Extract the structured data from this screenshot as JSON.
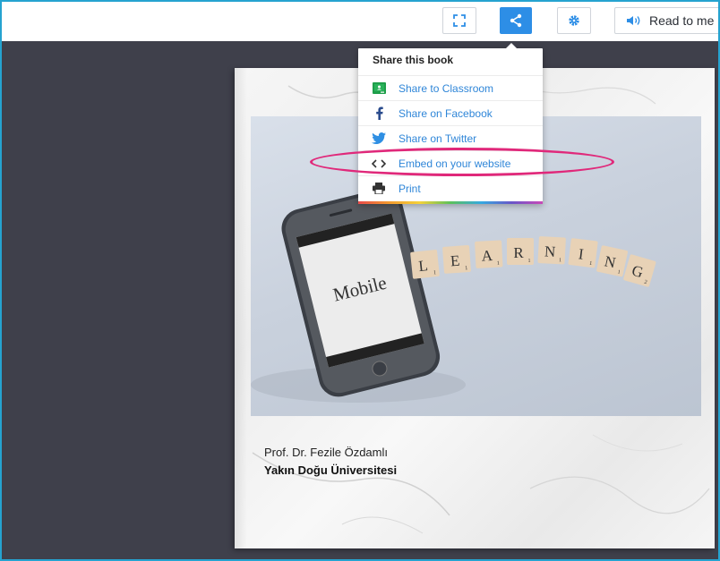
{
  "toolbar": {
    "fullscreen_icon": "fullscreen-icon",
    "share_icon": "share-icon",
    "settings_icon": "gear-icon",
    "read_icon": "speaker-icon",
    "read_label": "Read to me",
    "accent_color": "#2d8ee6"
  },
  "share_menu": {
    "title": "Share this book",
    "items": [
      {
        "label": "Share to Classroom",
        "icon": "google-classroom-icon"
      },
      {
        "label": "Share on Facebook",
        "icon": "facebook-icon"
      },
      {
        "label": "Share on Twitter",
        "icon": "twitter-icon"
      },
      {
        "label": "Embed on your website",
        "icon": "code-icon"
      },
      {
        "label": "Print",
        "icon": "printer-icon"
      }
    ]
  },
  "book": {
    "photo_text": {
      "phone_word": "Mobile",
      "tiles": [
        {
          "letter": "L",
          "num": "1"
        },
        {
          "letter": "E",
          "num": "1"
        },
        {
          "letter": "A",
          "num": "1"
        },
        {
          "letter": "R",
          "num": "1"
        },
        {
          "letter": "N",
          "num": "1"
        },
        {
          "letter": "I",
          "num": "1"
        },
        {
          "letter": "N",
          "num": "1"
        },
        {
          "letter": "G",
          "num": "2"
        }
      ]
    },
    "author": "Prof. Dr. Fezile Özdamlı",
    "publisher": "Yakın Doğu Üniversitesi"
  },
  "annotation": {
    "highlight_color": "#e0287a"
  }
}
